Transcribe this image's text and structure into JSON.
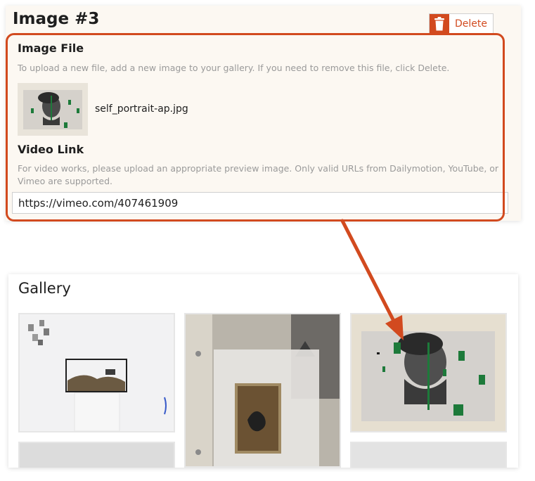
{
  "image_card": {
    "title": "Image #3",
    "delete_label": "Delete",
    "image_file": {
      "heading": "Image File",
      "help": "To upload a new file, add a new image to your gallery. If you need to remove this file, click Delete.",
      "filename": "self_portrait-ap.jpg"
    },
    "video_link": {
      "heading": "Video Link",
      "help_line1": "For video works, please upload an appropriate preview image. Only valid URLs from Dailymotion, YouTube, or",
      "help_line2": "Vimeo are supported.",
      "value": "https://vimeo.com/407461909"
    }
  },
  "gallery": {
    "title": "Gallery"
  },
  "colors": {
    "accent": "#d24a1f",
    "card_bg": "#fcf8f2",
    "muted_text": "#9a9a9a"
  },
  "icons": [
    "trash-icon"
  ]
}
